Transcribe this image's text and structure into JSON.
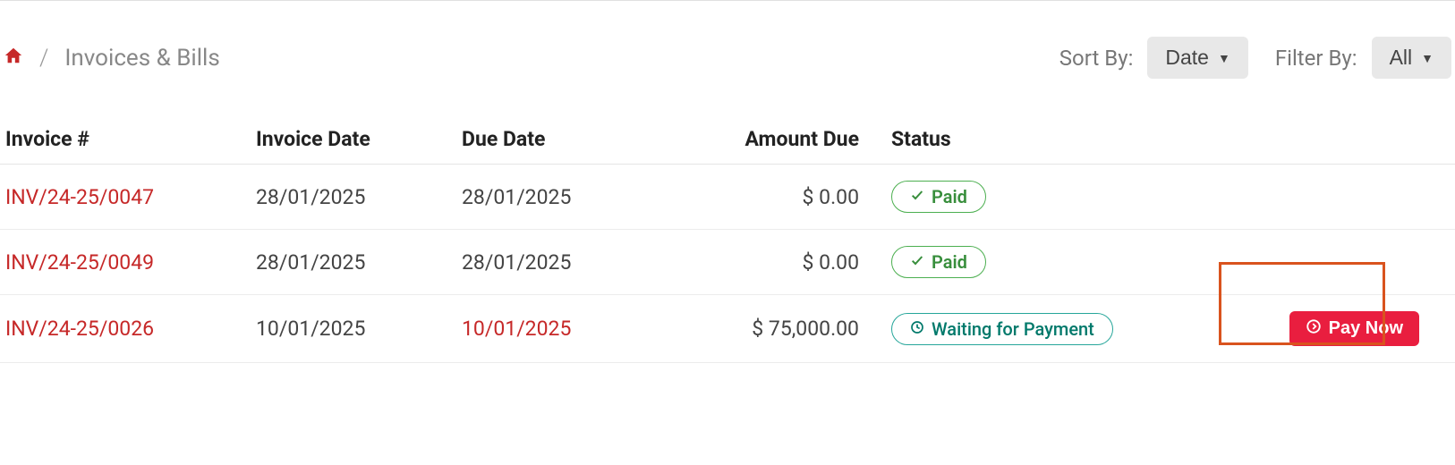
{
  "breadcrumb": {
    "home_icon": "home-icon",
    "separator": "/",
    "title": "Invoices & Bills"
  },
  "controls": {
    "sort_label": "Sort By:",
    "sort_value": "Date",
    "filter_label": "Filter By:",
    "filter_value": "All"
  },
  "table": {
    "headers": {
      "invoice_no": "Invoice #",
      "invoice_date": "Invoice Date",
      "due_date": "Due Date",
      "amount_due": "Amount Due",
      "status": "Status"
    },
    "rows": [
      {
        "invoice_no": "INV/24-25/0047",
        "invoice_date": "28/01/2025",
        "due_date": "28/01/2025",
        "due_date_overdue": false,
        "amount_due": "$ 0.00",
        "status_type": "paid",
        "status_label": "Paid",
        "action": null
      },
      {
        "invoice_no": "INV/24-25/0049",
        "invoice_date": "28/01/2025",
        "due_date": "28/01/2025",
        "due_date_overdue": false,
        "amount_due": "$ 0.00",
        "status_type": "paid",
        "status_label": "Paid",
        "action": null
      },
      {
        "invoice_no": "INV/24-25/0026",
        "invoice_date": "10/01/2025",
        "due_date": "10/01/2025",
        "due_date_overdue": true,
        "amount_due": "$ 75,000.00",
        "status_type": "waiting",
        "status_label": "Waiting for Payment",
        "action": "Pay Now"
      }
    ]
  },
  "colors": {
    "accent_red": "#c62828",
    "paid_green": "#388e3c",
    "waiting_teal": "#00796b",
    "pay_btn_bg": "#e91e3f",
    "highlight_border": "#d9531e"
  }
}
